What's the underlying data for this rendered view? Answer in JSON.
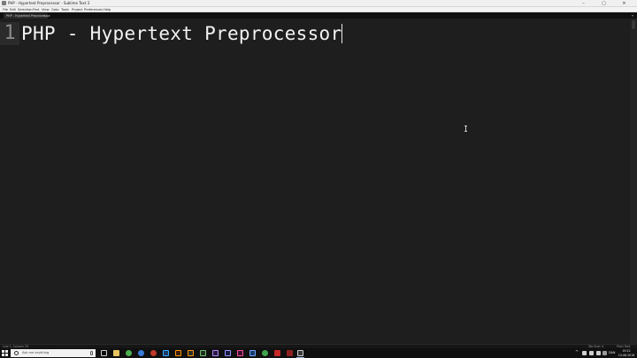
{
  "window": {
    "title": "PHP - Hypertext Preprocessor - Sublime Text 3",
    "minimize": "–",
    "maximize": "▢",
    "close": "✕"
  },
  "menu": [
    "File",
    "Edit",
    "Selection",
    "Find",
    "View",
    "Goto",
    "Tools",
    "Project",
    "Preferences",
    "Help"
  ],
  "tab": {
    "label": "PHP - Hypertext Preprocessor",
    "close": "×",
    "right_icon": "▾"
  },
  "editor": {
    "line_number": "1",
    "line_text": "PHP - Hypertext Preprocessor"
  },
  "status": {
    "left": "Line 1, Column 29",
    "tab_size": "Tab Size: 4",
    "syntax": "Plain Text"
  },
  "taskbar": {
    "search_placeholder": "Ask me anything",
    "tray_up": "^",
    "language": "DAN",
    "time": "19:22",
    "date": "10-06-2016"
  },
  "colors": {
    "editor_bg": "#1e1e1e",
    "text": "#f2f2f2",
    "line_number": "#8a8a8a",
    "taskbar_bg": "#101010"
  },
  "icons": [
    "app-icon",
    "start-icon",
    "search-icon",
    "mic-icon",
    "task-view-icon",
    "file-explorer-icon",
    "chrome-icon",
    "edge-icon",
    "app-red-icon",
    "photoshop-icon",
    "illustrator-icon",
    "sublime-icon",
    "terminal-icon",
    "premiere-icon",
    "aftereffects-icon",
    "ie-icon",
    "store-icon",
    "filezilla-icon",
    "acrobat-icon",
    "screen-icon"
  ]
}
